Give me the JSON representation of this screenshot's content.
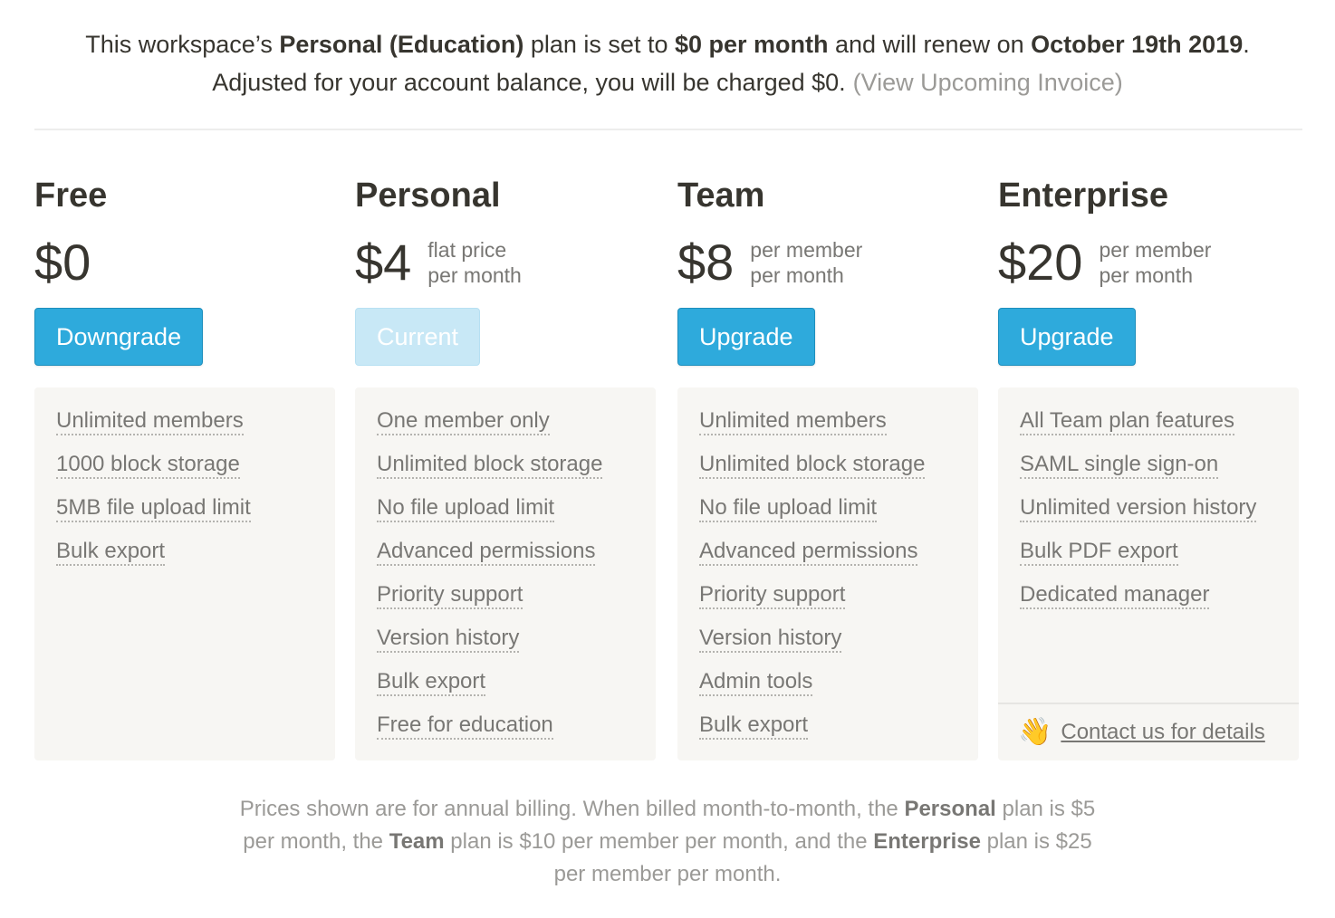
{
  "summary": {
    "line1": {
      "t1": "This workspace’s ",
      "plan": "Personal (Education)",
      "t2": " plan is set to ",
      "price": "$0 per month",
      "t3": " and will renew on ",
      "date": "October 19th 2019",
      "t4": "."
    },
    "line2": {
      "text": "Adjusted for your account balance, you will be charged $0.",
      "link": "(View Upcoming Invoice)"
    }
  },
  "plans": [
    {
      "name": "Free",
      "price": "$0",
      "note1": "",
      "note2": "",
      "button": "Downgrade",
      "features": [
        "Unlimited members",
        "1000 block storage",
        "5MB file upload limit",
        "Bulk export"
      ]
    },
    {
      "name": "Personal",
      "price": "$4",
      "note1": "flat price",
      "note2": "per month",
      "button": "Current",
      "features": [
        "One member only",
        "Unlimited block storage",
        "No file upload limit",
        "Advanced permissions",
        "Priority support",
        "Version history",
        "Bulk export",
        "Free for education"
      ]
    },
    {
      "name": "Team",
      "price": "$8",
      "note1": "per member",
      "note2": "per month",
      "button": "Upgrade",
      "features": [
        "Unlimited members",
        "Unlimited block storage",
        "No file upload limit",
        "Advanced permissions",
        "Priority support",
        "Version history",
        "Admin tools",
        "Bulk export"
      ]
    },
    {
      "name": "Enterprise",
      "price": "$20",
      "note1": "per member",
      "note2": "per month",
      "button": "Upgrade",
      "features": [
        "All Team plan features",
        "SAML single sign-on",
        "Unlimited version history",
        "Bulk PDF export",
        "Dedicated manager"
      ],
      "contact": {
        "emoji": "👋",
        "icon": "waving-hand-icon",
        "label": "Contact us for details"
      }
    }
  ],
  "footnote": {
    "l1a": "Prices shown are for annual billing. When billed month-to-month, the ",
    "l1b": "Personal",
    "l1c": " plan is $5",
    "l2a": "per month, the ",
    "l2b": "Team",
    "l2c": " plan is $10 per member per month, and the ",
    "l2d": "Enterprise",
    "l2e": " plan is $25",
    "l3": "per member per month."
  },
  "colors": {
    "accent": "#2eaadc",
    "accent_disabled": "#c8e8f6",
    "card_bg": "#f7f6f3",
    "text": "#37352f",
    "muted": "#787774"
  }
}
